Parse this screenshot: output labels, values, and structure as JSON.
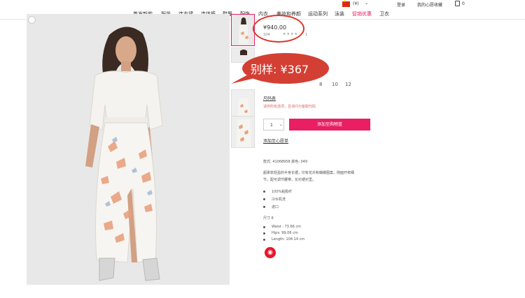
{
  "topbar": {
    "currency": "(¥)",
    "currency_caret": "⌄",
    "login": "登录",
    "wishlist_link": "我的心愿收藏",
    "bag_count": "0"
  },
  "nav": {
    "items": [
      "首发新款",
      "服装",
      "连衣裙",
      "连体裤",
      "鞋履",
      "配饰",
      "内衣",
      "美妆和养颜",
      "运动系列",
      "泳装",
      "促销优惠",
      "卫衣"
    ],
    "active_index": 10
  },
  "product": {
    "price": "¥940.00",
    "sku_short": "104",
    "stars": "★★★★",
    "review_count": "1",
    "sizes": [
      "8",
      "10",
      "12"
    ],
    "size_chart": "尺码表",
    "stock_note": "请你所有选项，且询问为客服代码",
    "qty": "1",
    "add_to_cart": "添加至购物篮",
    "add_to_wishlist": "添加至心愿单",
    "style_line": "款式: 41068958 颜色: 049",
    "description_1": "超柔软轻盈的半身长裙，印有花卉和蝴蝶图案，侧面开衩细",
    "description_2": "节，配可调节腰带，长衬裙衬里。",
    "features": [
      "100%粘胶纤",
      "冷水机洗",
      "进口"
    ],
    "size_label": "尺寸 6",
    "measurements": [
      "Waist : 73.66 cm",
      "Hips: 99.06 cm",
      "Length: 104.14 cm"
    ]
  },
  "annotation": {
    "callout_text": "别样: ¥367",
    "circle_color": "#d9362b",
    "bubble_color": "#d43f34"
  },
  "colors": {
    "accent": "#e91e63",
    "weibo": "#e6162d"
  },
  "icons": {
    "weibo": "weibo-icon",
    "bag": "shopping-bag-icon",
    "flag": "china-flag-icon"
  }
}
